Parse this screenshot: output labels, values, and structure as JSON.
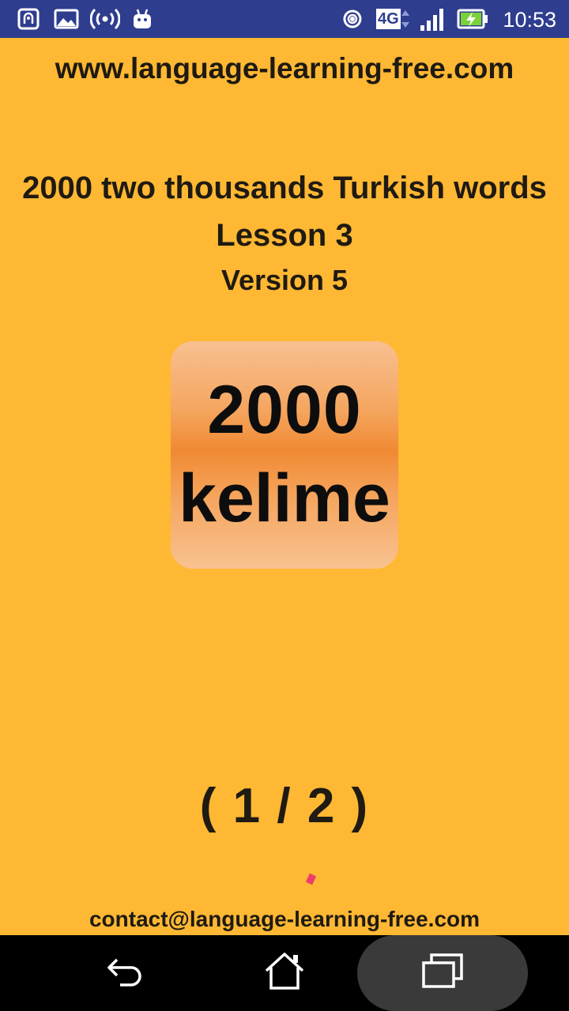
{
  "status_bar": {
    "time": "10:53",
    "network_label": "4G",
    "icons": [
      "nfc-icon",
      "gallery-icon",
      "hotspot-icon",
      "android-icon",
      "wireless-icon",
      "network-4g-icon",
      "signal-icon",
      "battery-charging-icon"
    ],
    "background_color": "#2F3D8F"
  },
  "header": {
    "url": "www.language-learning-free.com"
  },
  "main": {
    "title": "2000 two thousands Turkish words",
    "lesson": "Lesson 3",
    "version": "Version 5",
    "logo": {
      "line1": "2000",
      "line2": "kelime"
    },
    "pager": "( 1 / 2 )"
  },
  "footer": {
    "contact": "contact@language-learning-free.com"
  },
  "nav_bar": {
    "buttons": [
      "back-icon",
      "home-icon",
      "recents-icon"
    ]
  },
  "colors": {
    "background": "#FFB833",
    "text": "#1f1a12",
    "accent_spark": "#EA3D6E"
  }
}
